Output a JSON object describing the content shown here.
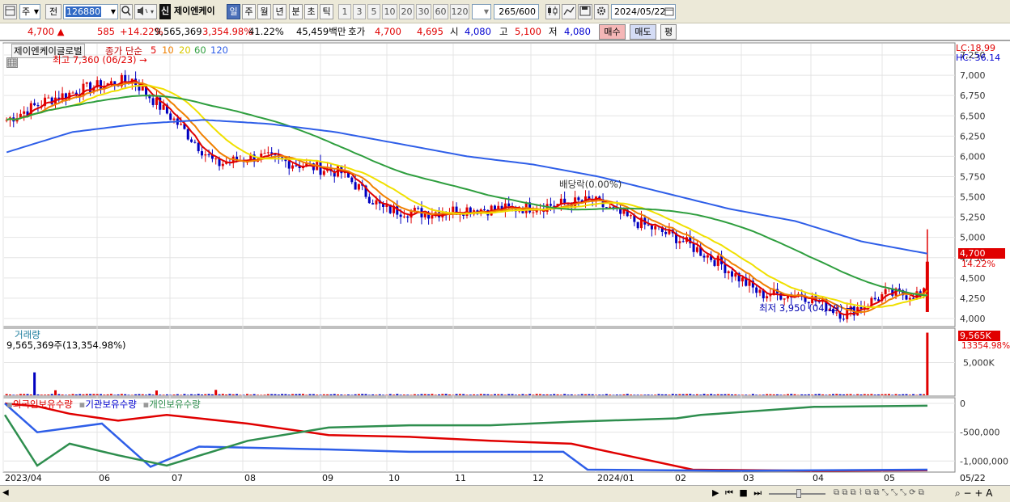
{
  "toolbar": {
    "period_main": "주",
    "prev_label": "전",
    "ticker_code": "126880",
    "new_badge": "신",
    "stock_name": "제이엔케이",
    "periods": [
      "일",
      "주",
      "월",
      "년",
      "분",
      "초",
      "틱"
    ],
    "active_period": "일",
    "intervals": [
      "1",
      "3",
      "5",
      "10",
      "20",
      "30",
      "60",
      "120"
    ],
    "count": "265/600",
    "date": "2024/05/22"
  },
  "quote": {
    "price": "4,700",
    "change": "585",
    "change_pct": "+14.22%",
    "volume": "9,565,369",
    "volume_pct": "3,354.98%",
    "turnover": "41.22%",
    "amount": "45,459백만",
    "ask_label": "호가",
    "ask": "4,700",
    "bid": "4,695",
    "open_label": "시",
    "open": "4,080",
    "high_label": "고",
    "high": "5,100",
    "low_label": "저",
    "low": "4,080",
    "buy_label": "매수",
    "sell_label": "매도",
    "eval_label": "평"
  },
  "price_panel": {
    "title": "제이엔케이글로벌",
    "legend_prefix": "종가 단순",
    "ma_labels": [
      "5",
      "10",
      "20",
      "60",
      "120"
    ],
    "ma_colors": [
      "#e00000",
      "#f08000",
      "#f0e000",
      "#2e9e3e",
      "#2e5ee8"
    ],
    "lc": "LC:18.99",
    "hc": "HC:-36.14",
    "high_note": "최고 7,360 (06/23)",
    "low_note": "최저 3,950 (04/19)",
    "dividend_note": "배당락(0.00%)",
    "last_price": "4,700",
    "last_pct": "14.22%",
    "y_ticks": [
      "7,250",
      "7,000",
      "6,750",
      "6,500",
      "6,250",
      "6,000",
      "5,750",
      "5,500",
      "5,250",
      "5,000",
      "4,750",
      "4,500",
      "4,250",
      "4,000"
    ]
  },
  "volume_panel": {
    "title": "거래량",
    "subtitle": "9,565,369주(13,354.98%)",
    "last_value": "9,565K",
    "last_pct": "13354.98%",
    "y_ticks": [
      "5,000K"
    ]
  },
  "holding_panel": {
    "labels": [
      "외국인보유수량",
      "기관보유수량",
      "개인보유수량"
    ],
    "colors": [
      "#e00000",
      "#2e5ee8",
      "#2e8e4e"
    ],
    "y_ticks": [
      "0",
      "-500,000",
      "-1,000,000"
    ]
  },
  "x_axis": [
    "2023/04",
    "06",
    "07",
    "08",
    "09",
    "10",
    "11",
    "12",
    "2024/01",
    "02",
    "03",
    "04",
    "05"
  ],
  "x_axis_right": "05/22",
  "chart_data": {
    "type": "candlestick",
    "title": "제이엔케이글로벌",
    "price_series": [
      {
        "name": "5",
        "values": [
          6450,
          6700,
          6850,
          6950,
          6450,
          5900,
          6000,
          5900,
          5800,
          5350,
          5300,
          5350,
          5350,
          5400,
          5450,
          5200,
          5000,
          4700,
          4300,
          4300,
          4050,
          4300,
          4300
        ]
      },
      {
        "name": "120",
        "values": [
          6050,
          6300,
          6400,
          6450,
          6400,
          6300,
          6150,
          6000,
          5900,
          5750,
          5550,
          5350,
          5200,
          4950,
          4800
        ]
      }
    ],
    "ylim": [
      3900,
      7400
    ],
    "high": {
      "value": 7360,
      "date": "06/23"
    },
    "low": {
      "value": 3950,
      "date": "04/19"
    },
    "last": {
      "value": 4700,
      "change_pct": 14.22
    },
    "volume_last": 9565369
  }
}
